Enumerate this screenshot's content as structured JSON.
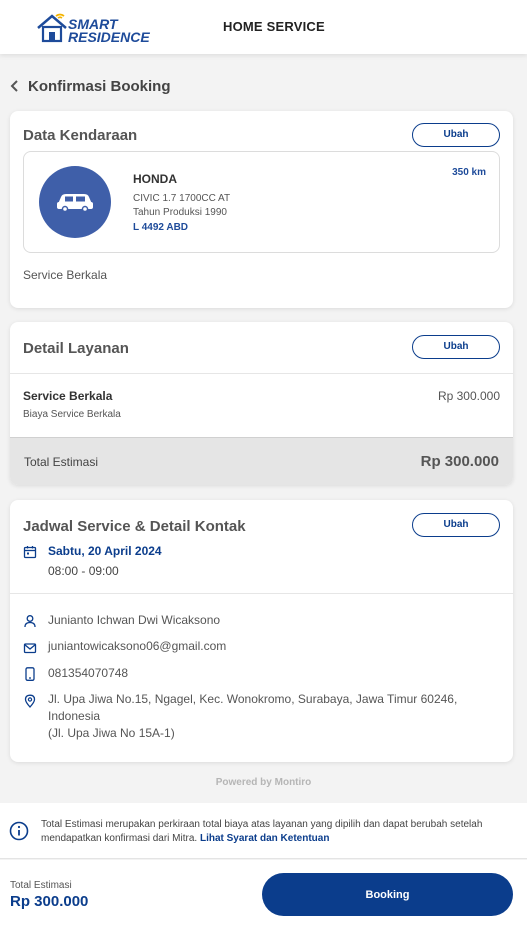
{
  "header": {
    "logo_text_line1": "SMART",
    "logo_text_line2": "RESIDENCE",
    "title": "HOME SERVICE"
  },
  "page": {
    "title": "Konfirmasi Booking"
  },
  "vehicle_card": {
    "title": "Data Kendaraan",
    "edit_label": "Ubah",
    "brand": "HONDA",
    "model": "CIVIC 1.7 1700CC AT",
    "year": "Tahun Produksi 1990",
    "plate": "L 4492 ABD",
    "mileage": "350 km",
    "service_type": "Service Berkala"
  },
  "service_card": {
    "title": "Detail Layanan",
    "edit_label": "Ubah",
    "item_name": "Service Berkala",
    "item_desc": "Biaya Service Berkala",
    "item_price": "Rp 300.000",
    "total_label": "Total Estimasi",
    "total_value": "Rp 300.000"
  },
  "schedule_card": {
    "title": "Jadwal Service & Detail Kontak",
    "edit_label": "Ubah",
    "date": "Sabtu, 20 April 2024",
    "time": "08:00 - 09:00",
    "name": "Junianto Ichwan Dwi Wicaksono",
    "email": "juniantowicaksono06@gmail.com",
    "phone": "081354070748",
    "address_line1": "Jl. Upa Jiwa No.15, Ngagel, Kec. Wonokromo, Surabaya, Jawa Timur 60246,",
    "address_line2": "Indonesia",
    "address_line3": "(Jl. Upa Jiwa No 15A-1)"
  },
  "powered_by": "Powered by Montiro",
  "info": {
    "text": "Total Estimasi merupakan perkiraan total biaya atas layanan yang dipilih dan dapat berubah setelah mendapatkan konfirmasi dari Mitra.",
    "link": "Lihat Syarat dan Ketentuan"
  },
  "footer": {
    "total_label": "Total Estimasi",
    "total_value": "Rp 300.000",
    "booking_label": "Booking"
  },
  "colors": {
    "primary": "#0b3d8c",
    "vehicle_circle": "#3f5fa9",
    "background": "#f3f3f3"
  },
  "icons": {
    "back": "chevron-left-icon",
    "car": "car-icon",
    "calendar": "calendar-icon",
    "user": "user-icon",
    "email": "mail-icon",
    "phone": "phone-icon",
    "location": "location-pin-icon",
    "info": "info-icon"
  }
}
